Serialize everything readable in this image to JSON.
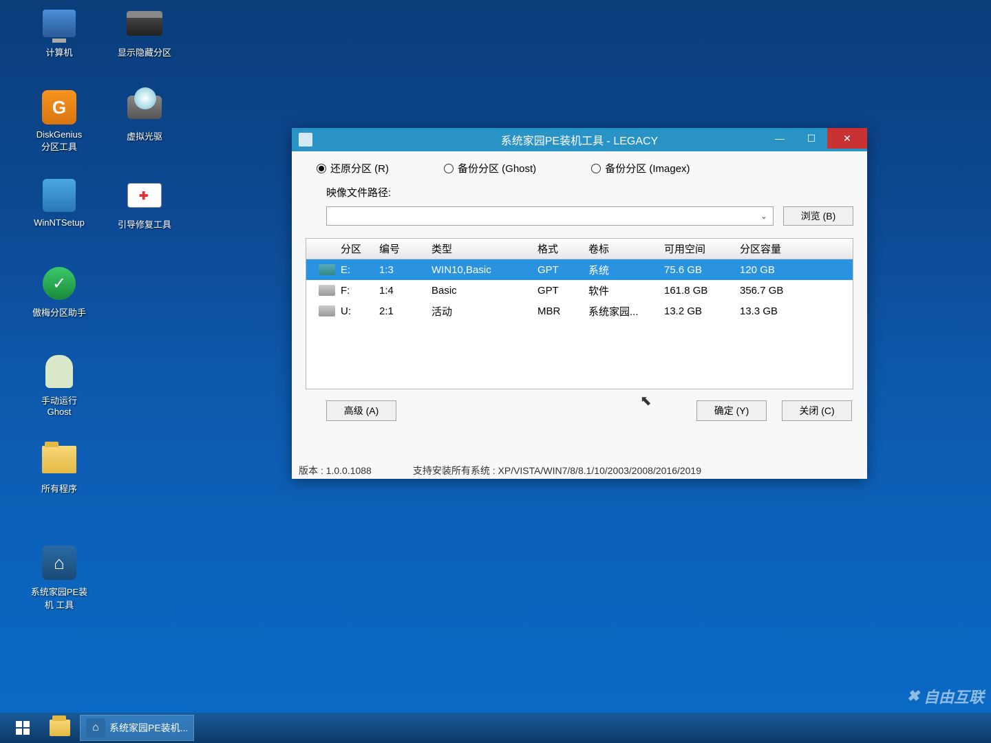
{
  "desktop": {
    "icons": [
      {
        "label": "计算机"
      },
      {
        "label": "显示隐藏分区"
      },
      {
        "label": "DiskGenius\n分区工具"
      },
      {
        "label": "虚拟光驱"
      },
      {
        "label": "WinNTSetup"
      },
      {
        "label": "引导修复工具"
      },
      {
        "label": "傲梅分区助手"
      },
      {
        "label": "手动运行\nGhost"
      },
      {
        "label": "所有程序"
      },
      {
        "label": "系统家园PE装\n机 工具"
      }
    ]
  },
  "window": {
    "title": "系统家园PE装机工具 - LEGACY",
    "radios": {
      "restore": "还原分区 (R)",
      "backup_ghost": "备份分区 (Ghost)",
      "backup_imagex": "备份分区 (Imagex)"
    },
    "path_label": "映像文件路径:",
    "browse": "浏览 (B)",
    "columns": {
      "drive": "分区",
      "num": "编号",
      "type": "类型",
      "fmt": "格式",
      "label": "卷标",
      "free": "可用空间",
      "size": "分区容量"
    },
    "rows": [
      {
        "drive": "E:",
        "num": "1:3",
        "type": "WIN10,Basic",
        "fmt": "GPT",
        "label": "系统",
        "free": "75.6 GB",
        "size": "120 GB",
        "selected": true
      },
      {
        "drive": "F:",
        "num": "1:4",
        "type": "Basic",
        "fmt": "GPT",
        "label": "软件",
        "free": "161.8 GB",
        "size": "356.7 GB",
        "selected": false
      },
      {
        "drive": "U:",
        "num": "2:1",
        "type": "活动",
        "fmt": "MBR",
        "label": "系统家园...",
        "free": "13.2 GB",
        "size": "13.3 GB",
        "selected": false
      }
    ],
    "buttons": {
      "advanced": "高级 (A)",
      "ok": "确定 (Y)",
      "close": "关闭 (C)"
    },
    "version": "版本 : 1.0.0.1088",
    "support": "支持安装所有系统 : XP/VISTA/WIN7/8/8.1/10/2003/2008/2016/2019"
  },
  "taskbar": {
    "active_app": "系统家园PE装机..."
  },
  "watermark": "自由互联"
}
